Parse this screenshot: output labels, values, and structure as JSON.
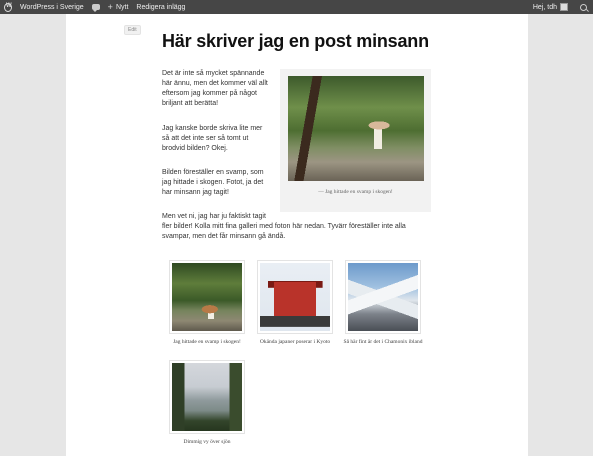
{
  "adminbar": {
    "site_name": "WordPress i Sverige",
    "new_label": "Nytt",
    "edit_post_label": "Redigera inlägg",
    "greeting": "Hej, tdh"
  },
  "post": {
    "edit_label": "Edit",
    "title": "Här skriver jag en post minsann",
    "paragraphs": [
      "Det är inte så mycket spännande här ännu, men det kommer väl allt eftersom jag kommer på något briljant att berätta!",
      "Jag kanske borde skriva lite mer så att det inte ser så tomt ut brodvid bilden? Okej.",
      "Bilden föreställer en svamp, som jag hittade i skogen. Fotot, ja det har minsann jag tagit!",
      "Men vet ni, jag har ju faktiskt tagit",
      "fler bilder! Kolla mitt fina galleri med foton här nedan. Tyvärr föreställer inte alla svampar, men det får minsann gå ändå."
    ],
    "featured_caption": "—   Jag hittade en svamp i skogen!"
  },
  "gallery": [
    {
      "caption": "Jag hittade en svamp i skogen!"
    },
    {
      "caption": "Okända japaner poserar i Kyoto"
    },
    {
      "caption": "Så här fint är det i Chamonix ibland"
    },
    {
      "caption": "Dimmig vy över sjön"
    }
  ]
}
